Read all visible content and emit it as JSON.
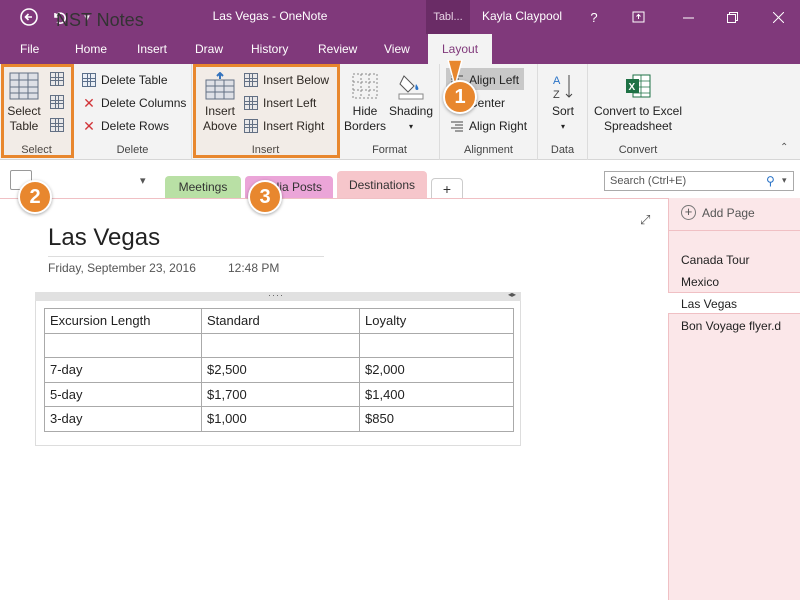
{
  "titlebar": {
    "title": "Las Vegas - OneNote",
    "context_tab": "Tabl...",
    "user": "Kayla Claypool",
    "help": "?"
  },
  "tabs": [
    "File",
    "Home",
    "Insert",
    "Draw",
    "History",
    "Review",
    "View",
    "Layout"
  ],
  "ribbon": {
    "select": {
      "label": "Select",
      "select_table": "Select\nTable"
    },
    "delete": {
      "label": "Delete",
      "delete_table": "Delete Table",
      "delete_columns": "Delete Columns",
      "delete_rows": "Delete Rows"
    },
    "insert": {
      "label": "Insert",
      "insert_above": "Insert\nAbove",
      "insert_below": "Insert Below",
      "insert_left": "Insert Left",
      "insert_right": "Insert Right"
    },
    "format": {
      "label": "Format",
      "hide_borders": "Hide\nBorders",
      "shading": "Shading"
    },
    "alignment": {
      "label": "Alignment",
      "align_left": "Align Left",
      "center": "Center",
      "align_right": "Align Right"
    },
    "data": {
      "label": "Data",
      "sort": "Sort"
    },
    "convert": {
      "label": "Convert",
      "convert_excel": "Convert to Excel\nSpreadsheet"
    }
  },
  "callouts": [
    "1",
    "2",
    "3"
  ],
  "notebook": {
    "name": "NST Notes",
    "sections": [
      {
        "label": "Meetings",
        "color": "#b9e0a5"
      },
      {
        "label": "Media Posts",
        "color": "#eba5d8"
      },
      {
        "label": "Destinations",
        "color": "#f6c6cb"
      }
    ],
    "add_section": "+",
    "search_placeholder": "Search (Ctrl+E)"
  },
  "page": {
    "title": "Las Vegas",
    "date": "Friday, September 23, 2016",
    "time": "12:48 PM",
    "table": {
      "headers": [
        "Excursion Length",
        "Standard",
        "Loyalty"
      ],
      "rows": [
        [
          "",
          "",
          ""
        ],
        [
          "7-day",
          "$2,500",
          "$2,000"
        ],
        [
          "5-day",
          "$1,700",
          "$1,400"
        ],
        [
          "3-day",
          "$1,000",
          "$850"
        ]
      ]
    }
  },
  "pages_panel": {
    "add_page": "Add Page",
    "items": [
      "Canada Tour",
      "Mexico",
      "Las Vegas",
      "Bon Voyage flyer.d"
    ]
  },
  "colors": {
    "accent": "#80397b",
    "callout": "#e8872e"
  }
}
